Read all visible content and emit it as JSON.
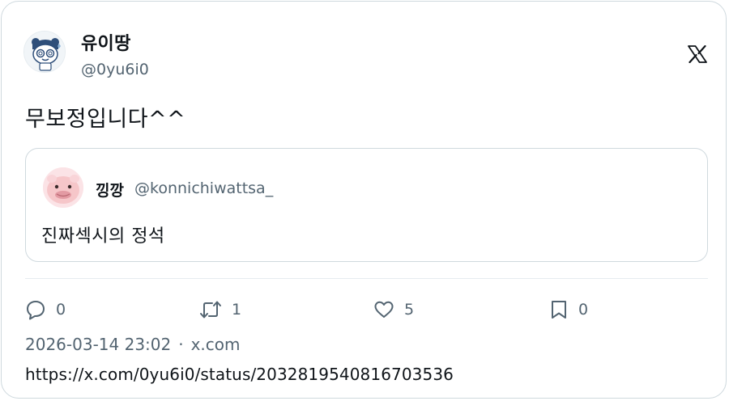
{
  "author": {
    "display_name": "유이땅",
    "handle": "@0yu6i0",
    "avatar_icon": "cartoon-avatar-icon"
  },
  "logo_icon": "x-logo-icon",
  "tweet": {
    "text": "무보정입니다^^"
  },
  "quoted": {
    "display_name": "낑깡",
    "handle": "@konnichiwattsa_",
    "text": "진짜섹시의 정석",
    "avatar_icon": "pink-creature-avatar-icon"
  },
  "actions": {
    "reply_count": "0",
    "retweet_count": "1",
    "like_count": "5",
    "bookmark_count": "0"
  },
  "meta": {
    "timestamp": "2026-03-14 23:02",
    "separator": "·",
    "source": "x.com"
  },
  "url": "https://x.com/0yu6i0/status/2032819540816703536",
  "colors": {
    "text": "#0f1419",
    "secondary": "#536471",
    "border": "#cfd9de"
  }
}
